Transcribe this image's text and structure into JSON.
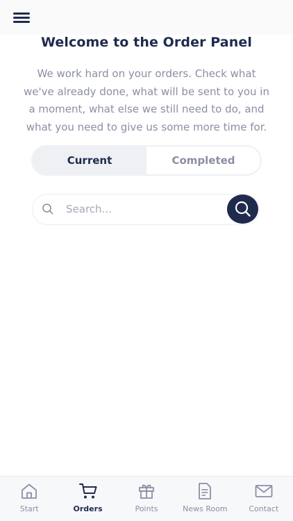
{
  "header": {
    "menu_icon": "hamburger-menu-icon"
  },
  "main": {
    "title": "Welcome to the Order Panel",
    "description": "We work hard on your orders. Check what we've already done, what will be sent to you in a moment, what else we still need to do, and what you need to give us some more time for. We",
    "tabs": [
      {
        "label": "Current",
        "active": true
      },
      {
        "label": "Completed",
        "active": false
      }
    ],
    "search": {
      "placeholder": "Search...",
      "value": "",
      "icon": "search-icon",
      "button_icon": "search-icon"
    }
  },
  "bottom_nav": {
    "items": [
      {
        "label": "Start",
        "icon": "home-icon",
        "active": false
      },
      {
        "label": "Orders",
        "icon": "cart-icon",
        "active": true
      },
      {
        "label": "Points",
        "icon": "gift-icon",
        "active": false
      },
      {
        "label": "News Room",
        "icon": "document-icon",
        "active": false
      },
      {
        "label": "Contact",
        "icon": "mail-icon",
        "active": false
      }
    ]
  },
  "colors": {
    "primary": "#1f2a4d",
    "muted_text": "#8a8fa3",
    "tab_active_bg": "#eef0f4"
  }
}
